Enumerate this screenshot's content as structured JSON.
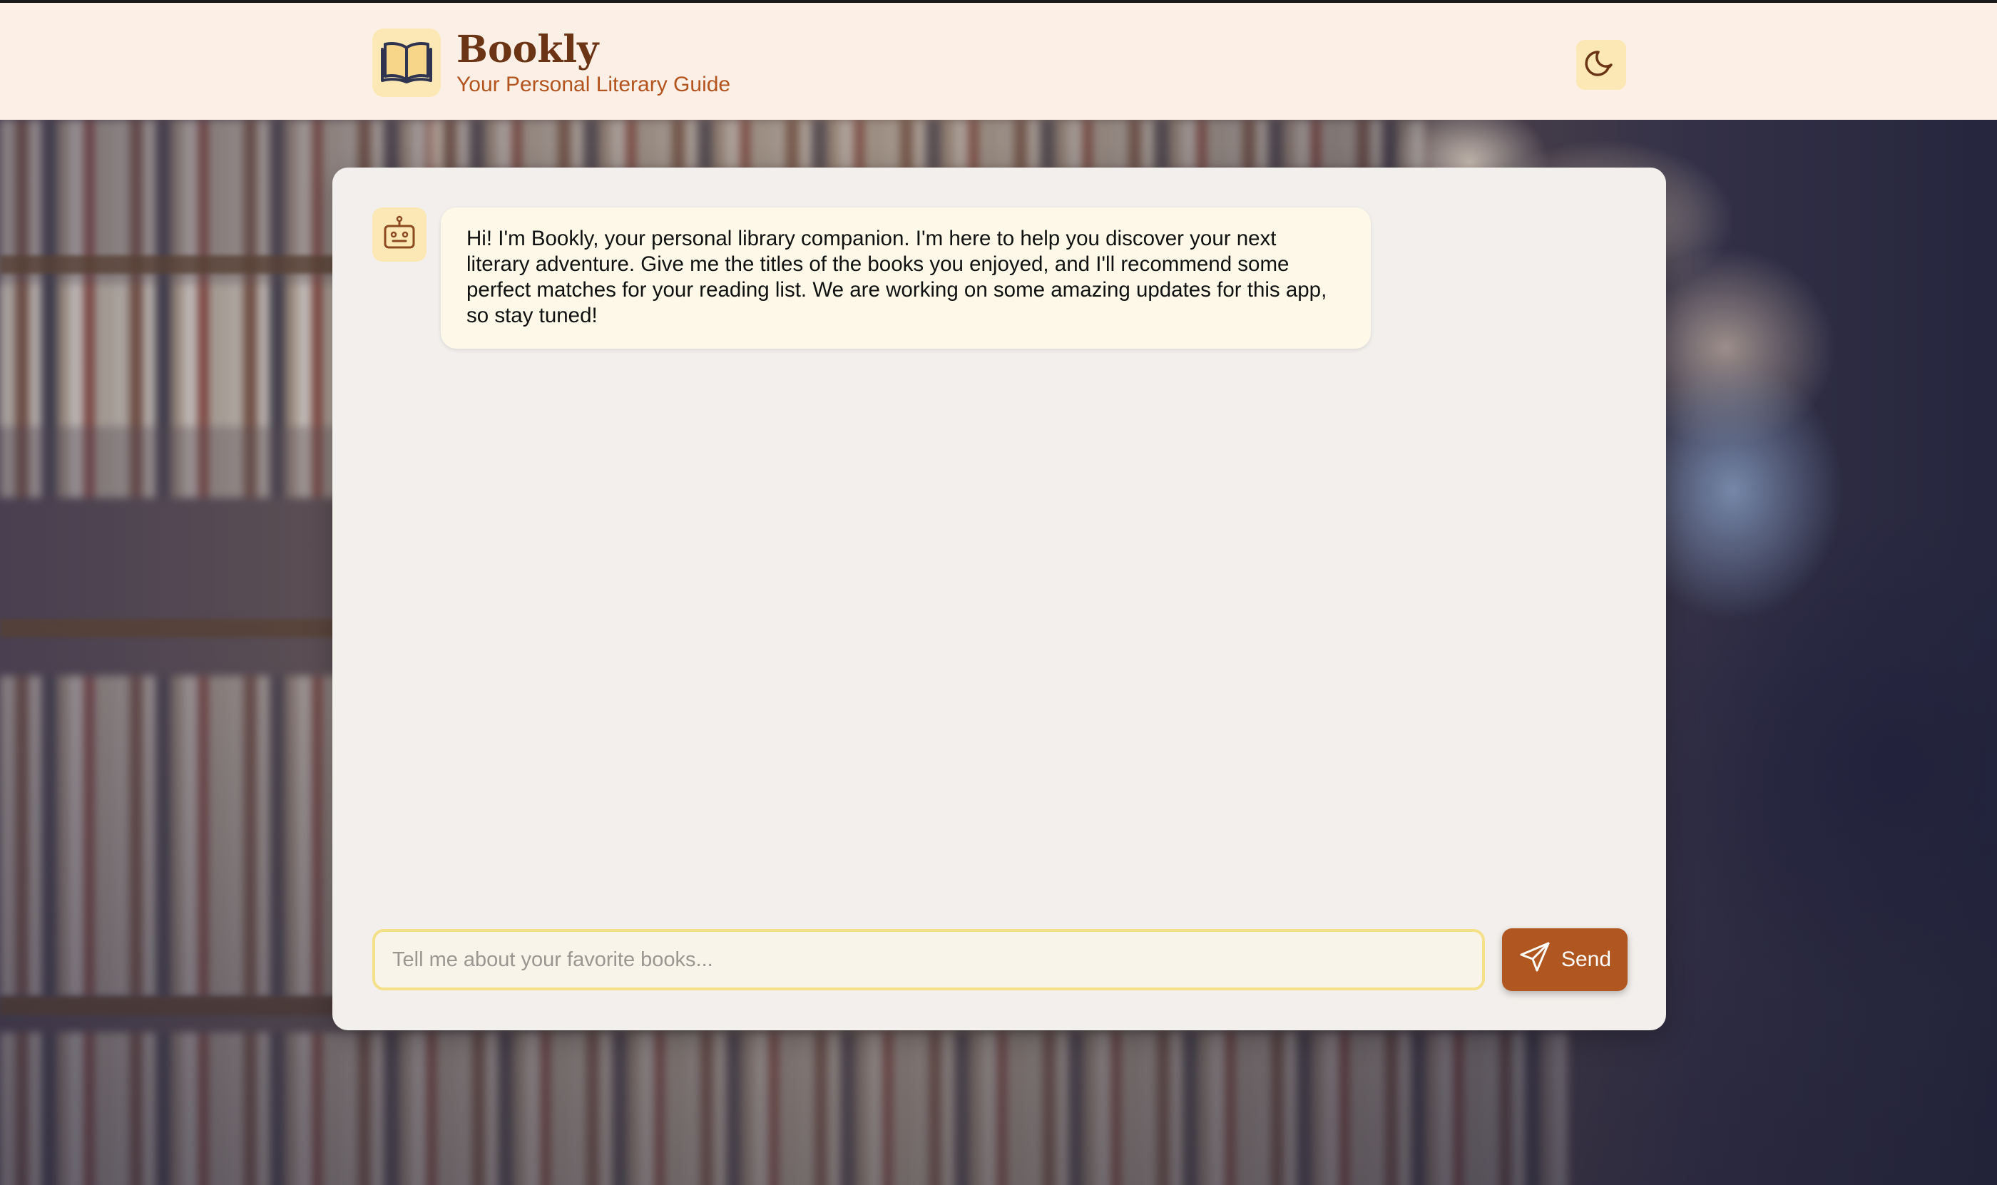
{
  "header": {
    "app_title": "Bookly",
    "app_subtitle": "Your Personal Literary Guide",
    "logo_icon": "open-book-icon",
    "theme_toggle_icon": "moon-icon"
  },
  "chat": {
    "messages": [
      {
        "sender": "bot",
        "avatar_icon": "robot-icon",
        "text": "Hi! I'm Bookly, your personal library companion. I'm here to help you discover your next literary adventure. Give me the titles of the books you enjoyed, and I'll recommend some perfect matches for your reading list. We are working on some amazing updates for this app, so stay tuned!"
      }
    ],
    "input": {
      "value": "",
      "placeholder": "Tell me about your favorite books..."
    },
    "send_button": {
      "label": "Send",
      "icon": "send-icon"
    }
  },
  "colors": {
    "header_bg": "#fcf0e6",
    "brand_title": "#6b3414",
    "brand_subtitle": "#b3541e",
    "icon_bg": "#fbe8b4",
    "panel_bg": "#f3efec",
    "bubble_bg": "#fdf8e8",
    "accent": "#b05620",
    "input_border": "#f5e08a"
  }
}
